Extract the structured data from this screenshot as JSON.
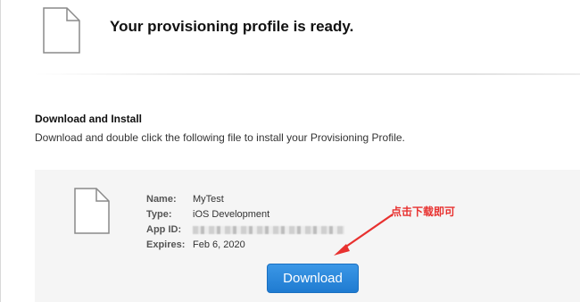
{
  "header": {
    "title": "Your provisioning profile is ready.",
    "icon": "document-icon"
  },
  "section": {
    "heading": "Download and Install",
    "description": "Download and double click the following file to install your Provisioning Profile."
  },
  "profile": {
    "icon": "document-icon",
    "fields": [
      {
        "key": "Name:",
        "value": "MyTest"
      },
      {
        "key": "Type:",
        "value": "iOS Development"
      },
      {
        "key": "App ID:",
        "value": "",
        "redacted": true
      },
      {
        "key": "Expires:",
        "value": "Feb 6, 2020"
      }
    ]
  },
  "download_button": {
    "label": "Download"
  },
  "annotation": {
    "text": "点击下载即可",
    "color": "#e8312f"
  },
  "colors": {
    "button_blue": "#1f7bd1",
    "panel_bg": "#f5f5f5"
  }
}
